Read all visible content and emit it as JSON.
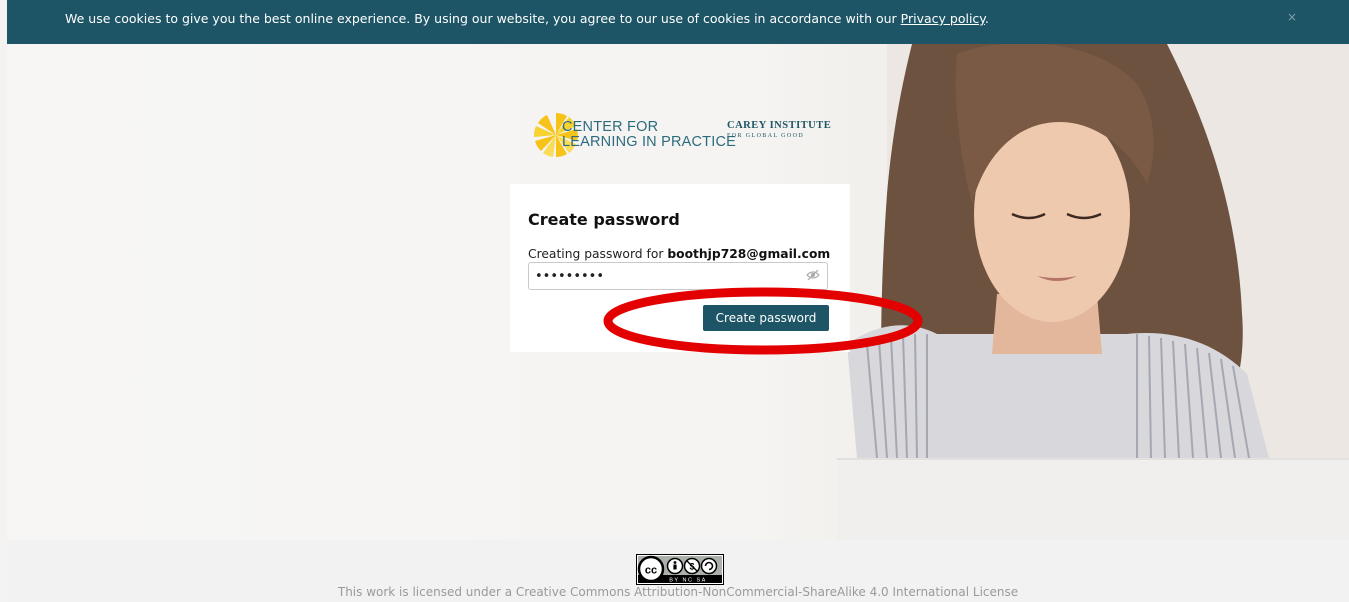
{
  "cookie_banner": {
    "text": "We use cookies to give you the best online experience. By using our website, you agree to our use of cookies in accordance with our",
    "link": "Privacy policy",
    "suffix": ".",
    "close": "×"
  },
  "logos": {
    "clip_line1": "CENTER FOR",
    "clip_line2": "LEARNING IN PRACTICE",
    "carey_line1": "CAREY INSTITUTE",
    "carey_line2": "FOR GLOBAL GOOD"
  },
  "form": {
    "title": "Create password",
    "creating_prefix": "Creating password for",
    "email": "boothjp728@gmail.com",
    "password_value": "•••••••••",
    "submit_label": "Create password"
  },
  "footer": {
    "cc_badge_text": "BY NC SA",
    "license": "This work is licensed under a Creative Commons Attribution-NonCommercial-ShareAlike 4.0 International License"
  },
  "colors": {
    "brand": "#1d5566",
    "annotation": "#e30000",
    "logo_yellow": "#f7c318"
  },
  "icons": {
    "close": "close-icon",
    "eye": "eye-slash-icon",
    "sun": "sun-logo-icon",
    "cc": "creative-commons-icon"
  }
}
